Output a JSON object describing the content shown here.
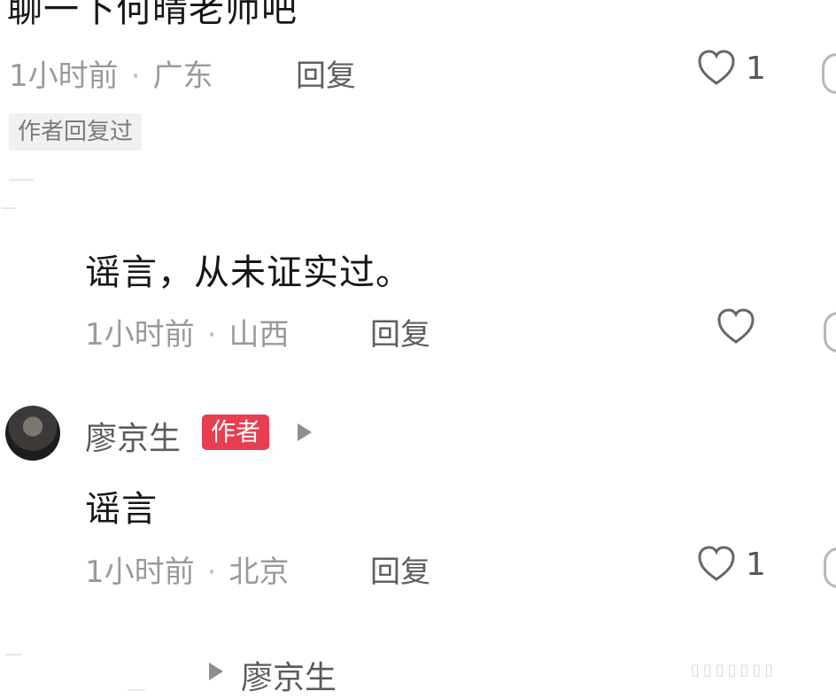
{
  "comment1": {
    "text": "聊一下何晴老师吧",
    "time": "1小时前",
    "location": "广东",
    "reply_label": "回复",
    "likes": "1",
    "tag": "作者回复过"
  },
  "comment2": {
    "text": "谣言，从未证实过。",
    "time": "1小时前",
    "location": "山西",
    "reply_label": "回复"
  },
  "comment3": {
    "author": "廖京生",
    "badge": "作者",
    "text": "谣言",
    "time": "1小时前",
    "location": "北京",
    "reply_label": "回复",
    "likes": "1"
  },
  "footer": {
    "reply_to": "廖京生"
  },
  "icons": {
    "like": "heart-outline-icon",
    "more": "cropped-icon",
    "play": "play-triangle-icon"
  },
  "colors": {
    "author_badge": "#e83e4f",
    "meta_text": "#9a9a9a"
  }
}
